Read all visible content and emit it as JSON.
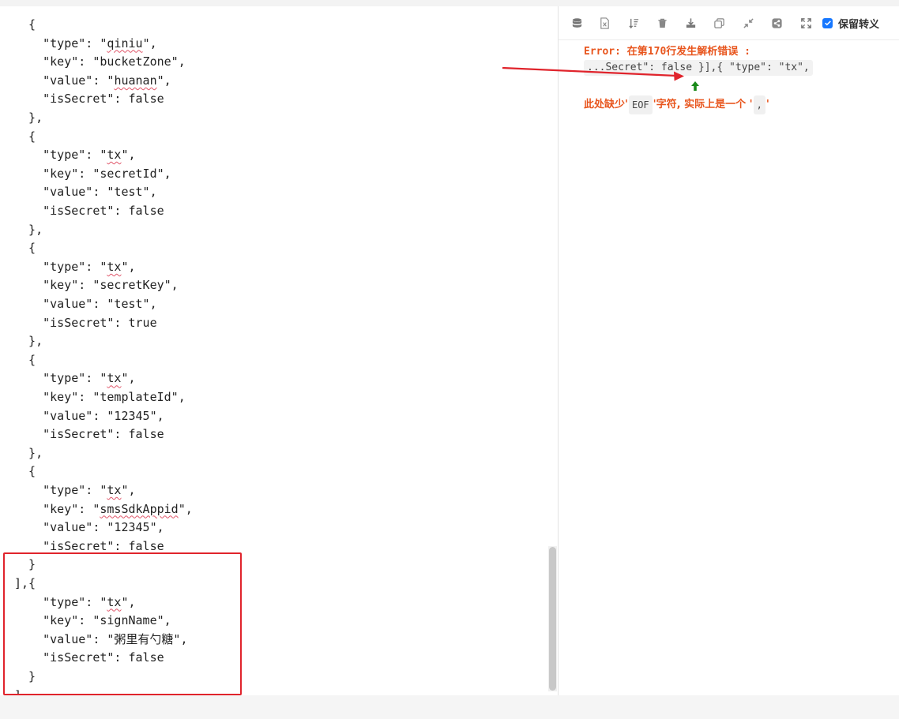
{
  "editor": {
    "lines": [
      "  {",
      "    \"type\": \"qiniu\",",
      "    \"key\": \"bucketZone\",",
      "    \"value\": \"huanan\",",
      "    \"isSecret\": false",
      "  },",
      "  {",
      "    \"type\": \"tx\",",
      "    \"key\": \"secretId\",",
      "    \"value\": \"test\",",
      "    \"isSecret\": false",
      "  },",
      "  {",
      "    \"type\": \"tx\",",
      "    \"key\": \"secretKey\",",
      "    \"value\": \"test\",",
      "    \"isSecret\": true",
      "  },",
      "  {",
      "    \"type\": \"tx\",",
      "    \"key\": \"templateId\",",
      "    \"value\": \"12345\",",
      "    \"isSecret\": false",
      "  },",
      "  {",
      "    \"type\": \"tx\",",
      "    \"key\": \"smsSdkAppid\",",
      "    \"value\": \"12345\",",
      "    \"isSecret\": false",
      "  }",
      "],{",
      "    \"type\": \"tx\",",
      "    \"key\": \"signName\",",
      "    \"value\": \"粥里有勺糖\",",
      "    \"isSecret\": false",
      "  }",
      "]"
    ],
    "squiggled_words": [
      "qiniu",
      "huanan",
      "tx",
      "smsSdkAppid"
    ]
  },
  "toolbar": {
    "icons": [
      "database-icon",
      "excel-icon",
      "sort-icon",
      "trash-icon",
      "download-icon",
      "copy-icon",
      "compress-icon",
      "share-icon",
      "fullscreen-icon"
    ],
    "keep_escape_label": "保留转义",
    "keep_escape_checked": true
  },
  "error": {
    "title": "Error: 在第170行发生解析错误 :",
    "snippet": "...Secret\": false }],{ \"type\": \"tx\",",
    "desc_prefix": "此处缺少'",
    "desc_code1": "EOF",
    "desc_middle": "'字符, 实际上是一个 '",
    "desc_code2": ",",
    "desc_suffix": "'"
  },
  "colors": {
    "error": "#e8551d",
    "annotation_red": "#e0242c",
    "pointer_green": "#1a8a1a",
    "checkbox_blue": "#1677ff"
  }
}
